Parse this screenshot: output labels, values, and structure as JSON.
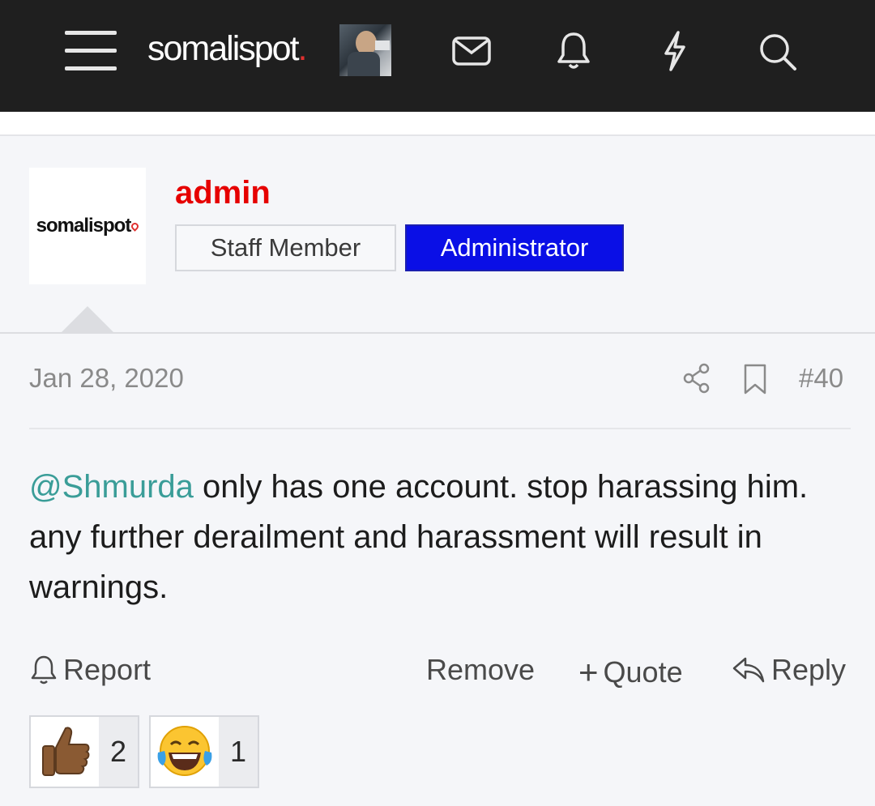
{
  "header": {
    "brand": "somalispot",
    "brand_dot": ".",
    "icons": [
      "menu-icon",
      "envelope-icon",
      "bell-icon",
      "lightning-icon",
      "search-icon"
    ]
  },
  "post": {
    "author": {
      "name": "admin",
      "avatar_text": "somalispot",
      "badges": [
        "Staff Member",
        "Administrator"
      ],
      "name_color": "#e60000",
      "admin_badge_color": "#0a0fe6"
    },
    "date": "Jan 28, 2020",
    "number": "#40",
    "mention": "@Shmurda",
    "body": " only has one account. stop harassing him. any further derailment and harassment will result in warnings.",
    "actions": {
      "report": "Report",
      "remove": "Remove",
      "quote": "Quote",
      "quote_prefix": "+",
      "reply": "Reply"
    },
    "reactions": [
      {
        "icon": "thumbs-up-icon",
        "count": "2"
      },
      {
        "icon": "laughing-tears-icon",
        "count": "1"
      }
    ]
  }
}
